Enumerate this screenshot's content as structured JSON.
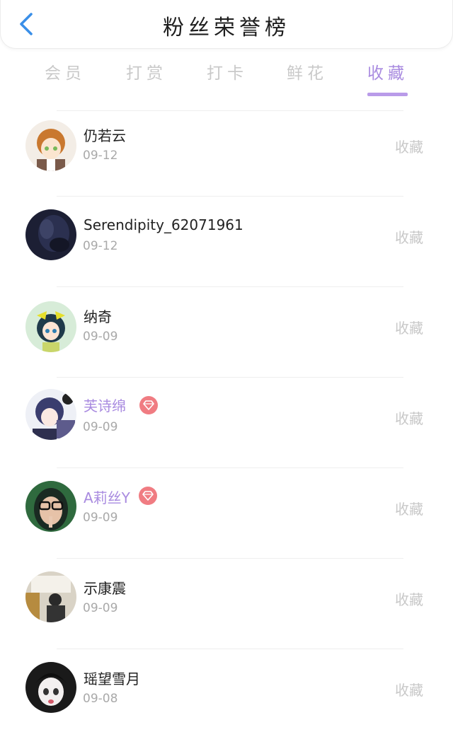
{
  "header": {
    "title": "粉丝荣誉榜",
    "back_icon": "chevron-left-icon"
  },
  "tabs": [
    {
      "label": "会员",
      "active": false
    },
    {
      "label": "打赏",
      "active": false
    },
    {
      "label": "打卡",
      "active": false
    },
    {
      "label": "鲜花",
      "active": false
    },
    {
      "label": "收藏",
      "active": true
    }
  ],
  "accent_color": "#a98be0",
  "fans": [
    {
      "name": "仍若云",
      "date": "09-12",
      "action": "收藏",
      "vip": false
    },
    {
      "name": "Serendipity_62071961",
      "date": "09-12",
      "action": "收藏",
      "vip": false
    },
    {
      "name": "纳奇",
      "date": "09-09",
      "action": "收藏",
      "vip": false
    },
    {
      "name": "芙诗绵",
      "date": "09-09",
      "action": "收藏",
      "vip": true
    },
    {
      "name": "A莉丝Y",
      "date": "09-09",
      "action": "收藏",
      "vip": true
    },
    {
      "name": "示康震",
      "date": "09-09",
      "action": "收藏",
      "vip": false
    },
    {
      "name": "瑶望雪月",
      "date": "09-08",
      "action": "收藏",
      "vip": false
    }
  ]
}
